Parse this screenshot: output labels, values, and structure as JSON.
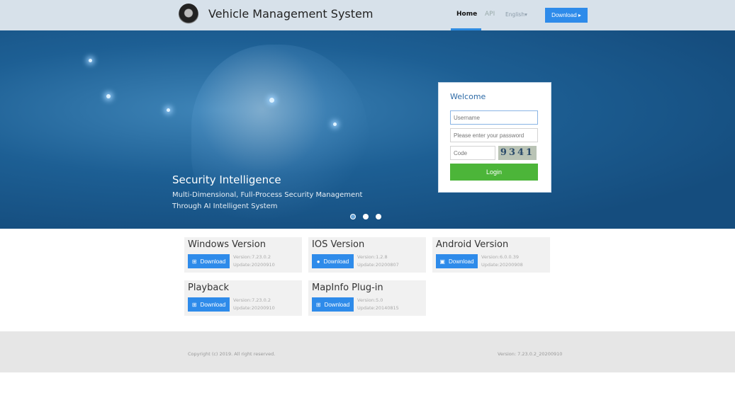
{
  "header": {
    "title": "Vehicle Management System",
    "nav": [
      "Home",
      "API",
      "English▾"
    ],
    "download": "Download ▸"
  },
  "banner": {
    "title": "Security Intelligence",
    "subtitle_line1": "Multi-Dimensional, Full-Process Security Management",
    "subtitle_line2": "Through AI Intelligent System",
    "slides": 3,
    "active_slide": 1
  },
  "login": {
    "welcome": "Welcome",
    "username_placeholder": "Username",
    "password_placeholder": "Please enter your password",
    "code_placeholder": "Code",
    "captcha": "9341",
    "button": "Login"
  },
  "cards": [
    {
      "title": "Windows Version",
      "button": "Download",
      "icon": "windows-icon",
      "version": "Version:7.23.0.2",
      "update": "Update:20200910"
    },
    {
      "title": "IOS Version",
      "button": "Download",
      "icon": "apple-icon",
      "version": "Version:1.2.8",
      "update": "Update:20200807"
    },
    {
      "title": "Android Version",
      "button": "Download",
      "icon": "android-icon",
      "version": "Version:6.0.0.39",
      "update": "Update:20200908"
    },
    {
      "title": "Playback",
      "button": "Download",
      "icon": "windows-icon",
      "version": "Version:7.23.0.2",
      "update": "Update:20200910"
    },
    {
      "title": "MapInfo Plug-in",
      "button": "Download",
      "icon": "windows-icon",
      "version": "Version:5.0",
      "update": "Update:20140815"
    }
  ],
  "footer": {
    "copyright": "Copyright (c) 2019. All right reserved.",
    "version": "Version: 7.23.0.2_20200910"
  },
  "colors": {
    "accent": "#2e8bea",
    "login": "#4cb539",
    "welcome": "#2d6aa6"
  }
}
